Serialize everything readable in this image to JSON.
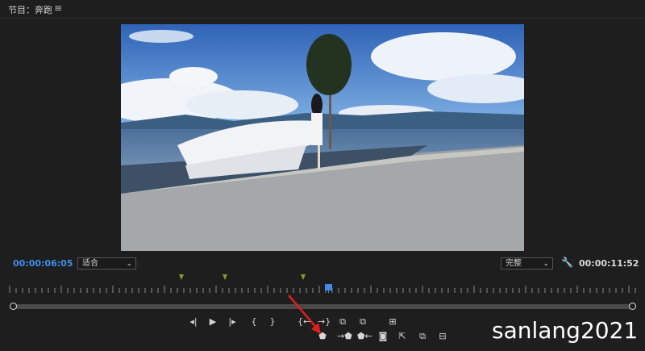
{
  "panel": {
    "title": "节目：奔跑",
    "menu_icon": "hamburger-icon"
  },
  "timecode": {
    "current": "00:00:06:05",
    "duration": "00:00:11:52"
  },
  "zoom_select": {
    "value": "适合"
  },
  "quality_select": {
    "value": "完整"
  },
  "watermark": "sanlang2021",
  "colors": {
    "accent": "#3d8fe8",
    "marker": "#8a9a2c",
    "background": "#1e1e1e"
  },
  "controls": {
    "row1": [
      "step-back-icon",
      "play-icon",
      "step-forward-icon",
      "mark-in-icon",
      "mark-out-icon",
      "go-to-in-icon",
      "go-to-out-icon",
      "lift-icon",
      "extract-icon",
      "button-editor-icon"
    ],
    "row2": [
      "add-marker-icon",
      "insert-icon",
      "overwrite-icon",
      "camera-icon",
      "export-frame-icon",
      "compare-icon",
      "multicam-icon"
    ]
  }
}
